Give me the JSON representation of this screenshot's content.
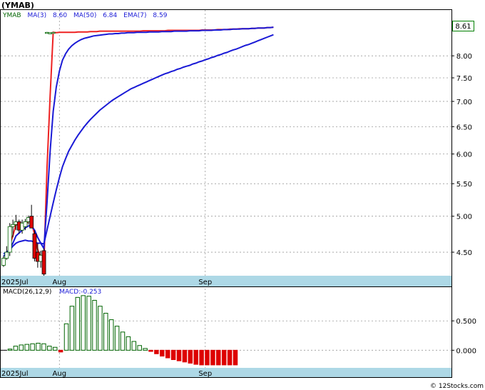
{
  "ticker_title": "(YMAB)",
  "footer": "© 12Stocks.com",
  "legend": {
    "symbol": "YMAB",
    "ma3_label": "MA(3)",
    "ma3_value": "8.60",
    "ma50_label": "MA(50)",
    "ma50_value": "6.84",
    "ema7_label": "EMA(7)",
    "ema7_value": "8.59"
  },
  "last_price": "8.61",
  "macd_legend": {
    "label": "MACD(26,12,9)",
    "value_label": "MACD:-0.253"
  },
  "colors": {
    "up": "#006400",
    "down": "#dd0000",
    "ma": "#1a1ad6",
    "ema": "#ee2222",
    "axis_band": "#add8e6",
    "label_box_border": "#008000"
  },
  "chart_data": [
    {
      "type": "candlestick",
      "scale": "log",
      "ylim": [
        4.2,
        9.15
      ],
      "y_ticks": [
        "4.50",
        "5.00",
        "5.50",
        "6.00",
        "6.50",
        "7.00",
        "7.50",
        "8.00"
      ],
      "x_ticks": [
        "2025Jul",
        "Aug",
        "Sep"
      ],
      "candles": [
        {
          "o": 4.33,
          "h": 4.45,
          "l": 4.31,
          "c": 4.42
        },
        {
          "o": 4.42,
          "h": 4.58,
          "l": 4.4,
          "c": 4.5
        },
        {
          "o": 4.5,
          "h": 4.9,
          "l": 4.45,
          "c": 4.85
        },
        {
          "o": 4.85,
          "h": 4.95,
          "l": 4.7,
          "c": 4.88
        },
        {
          "o": 4.88,
          "h": 5.02,
          "l": 4.8,
          "c": 4.92
        },
        {
          "o": 4.92,
          "h": 4.95,
          "l": 4.75,
          "c": 4.8
        },
        {
          "o": 4.8,
          "h": 4.95,
          "l": 4.75,
          "c": 4.9
        },
        {
          "o": 4.85,
          "h": 4.96,
          "l": 4.8,
          "c": 4.92
        },
        {
          "o": 4.92,
          "h": 5.01,
          "l": 4.88,
          "c": 4.98
        },
        {
          "o": 5.0,
          "h": 5.17,
          "l": 4.83,
          "c": 4.83
        },
        {
          "o": 4.75,
          "h": 4.8,
          "l": 4.38,
          "c": 4.42
        },
        {
          "o": 4.5,
          "h": 4.62,
          "l": 4.3,
          "c": 4.38
        },
        {
          "o": 4.38,
          "h": 4.52,
          "l": 4.3,
          "c": 4.46
        },
        {
          "o": 4.52,
          "h": 4.55,
          "l": 4.2,
          "c": 4.22
        },
        {
          "o": 8.56,
          "h": 8.58,
          "l": 8.55,
          "c": 8.57
        },
        {
          "o": 8.56,
          "h": 8.57,
          "l": 8.55,
          "c": 8.56
        },
        {
          "o": 8.57,
          "h": 8.58,
          "l": 8.56,
          "c": 8.57
        }
      ],
      "series": [
        {
          "values": [
            4.38,
            4.45,
            4.59,
            4.72,
            4.88,
            4.87,
            4.87,
            4.87,
            4.93,
            4.91,
            4.74,
            4.54,
            4.42,
            4.35,
            5.75,
            7.12,
            8.57,
            8.56,
            8.57,
            8.57,
            8.57,
            8.57,
            8.57,
            8.57,
            8.58,
            8.58,
            8.58,
            8.58,
            8.59,
            8.59,
            8.59,
            8.6,
            8.6,
            8.6,
            8.6,
            8.6,
            8.6,
            8.6,
            8.6,
            8.6,
            8.6,
            8.6,
            8.6,
            8.6,
            8.6,
            8.61,
            8.61,
            8.61,
            8.61,
            8.61,
            8.61,
            8.61,
            8.61,
            8.62,
            8.62,
            8.62,
            8.62,
            8.62,
            8.62,
            8.62,
            8.62,
            8.62,
            8.62,
            8.62,
            8.63,
            8.63,
            8.63,
            8.63,
            8.63,
            8.64,
            8.64,
            8.64,
            8.64,
            8.65,
            8.65,
            8.65,
            8.66,
            8.66,
            8.66,
            8.66,
            8.67,
            8.67,
            8.68,
            8.68,
            8.68,
            8.69,
            8.69,
            8.7
          ]
        },
        {
          "values": [
            4.48,
            4.5,
            4.53,
            4.58,
            4.62,
            4.64,
            4.65,
            4.66,
            4.65,
            4.65,
            4.63,
            4.62,
            4.62,
            4.61,
            4.8,
            5.0,
            5.2,
            5.4,
            5.6,
            5.78,
            5.92,
            6.05,
            6.15,
            6.25,
            6.34,
            6.42,
            6.5,
            6.57,
            6.64,
            6.7,
            6.76,
            6.82,
            6.87,
            6.92,
            6.97,
            7.02,
            7.06,
            7.1,
            7.14,
            7.18,
            7.22,
            7.26,
            7.29,
            7.32,
            7.35,
            7.38,
            7.41,
            7.44,
            7.47,
            7.5,
            7.53,
            7.56,
            7.59,
            7.61,
            7.64,
            7.66,
            7.69,
            7.71,
            7.74,
            7.76,
            7.78,
            7.81,
            7.83,
            7.86,
            7.88,
            7.91,
            7.93,
            7.96,
            7.98,
            8.01,
            8.03,
            8.06,
            8.08,
            8.11,
            8.14,
            8.16,
            8.19,
            8.22,
            8.25,
            8.27,
            8.3,
            8.33,
            8.36,
            8.39,
            8.42,
            8.45,
            8.48,
            8.51
          ]
        },
        {
          "values": [
            4.45,
            4.48,
            4.55,
            4.62,
            4.72,
            4.76,
            4.8,
            4.83,
            4.86,
            4.86,
            4.8,
            4.7,
            4.62,
            4.55,
            5.2,
            6.05,
            6.8,
            7.3,
            7.65,
            7.9,
            8.05,
            8.16,
            8.24,
            8.3,
            8.35,
            8.39,
            8.42,
            8.44,
            8.46,
            8.48,
            8.49,
            8.5,
            8.51,
            8.52,
            8.53,
            8.53,
            8.54,
            8.54,
            8.55,
            8.55,
            8.56,
            8.56,
            8.56,
            8.57,
            8.57,
            8.57,
            8.57,
            8.58,
            8.58,
            8.58,
            8.58,
            8.59,
            8.59,
            8.59,
            8.59,
            8.6,
            8.6,
            8.6,
            8.6,
            8.6,
            8.61,
            8.61,
            8.61,
            8.61,
            8.62,
            8.62,
            8.62,
            8.62,
            8.63,
            8.63,
            8.63,
            8.64,
            8.64,
            8.64,
            8.65,
            8.65,
            8.65,
            8.66,
            8.66,
            8.66,
            8.67,
            8.67,
            8.68,
            8.68,
            8.68,
            8.69,
            8.69,
            8.7
          ]
        }
      ]
    },
    {
      "type": "bar",
      "ylim": [
        -0.3,
        1.05
      ],
      "y_ticks": [
        "0.500",
        "0.000"
      ],
      "x_ticks": [
        "2025Jul",
        "Aug",
        "Sep"
      ],
      "values": [
        0.02,
        0.07,
        0.09,
        0.1,
        0.11,
        0.12,
        0.11,
        0.07,
        0.05,
        -0.03,
        0.45,
        0.75,
        0.9,
        0.93,
        0.92,
        0.85,
        0.75,
        0.63,
        0.52,
        0.41,
        0.31,
        0.23,
        0.15,
        0.08,
        0.03,
        -0.02,
        -0.06,
        -0.1,
        -0.13,
        -0.16,
        -0.18,
        -0.2,
        -0.22,
        -0.24,
        -0.25,
        -0.25,
        -0.25,
        -0.25,
        -0.25,
        -0.25,
        -0.25
      ]
    }
  ]
}
